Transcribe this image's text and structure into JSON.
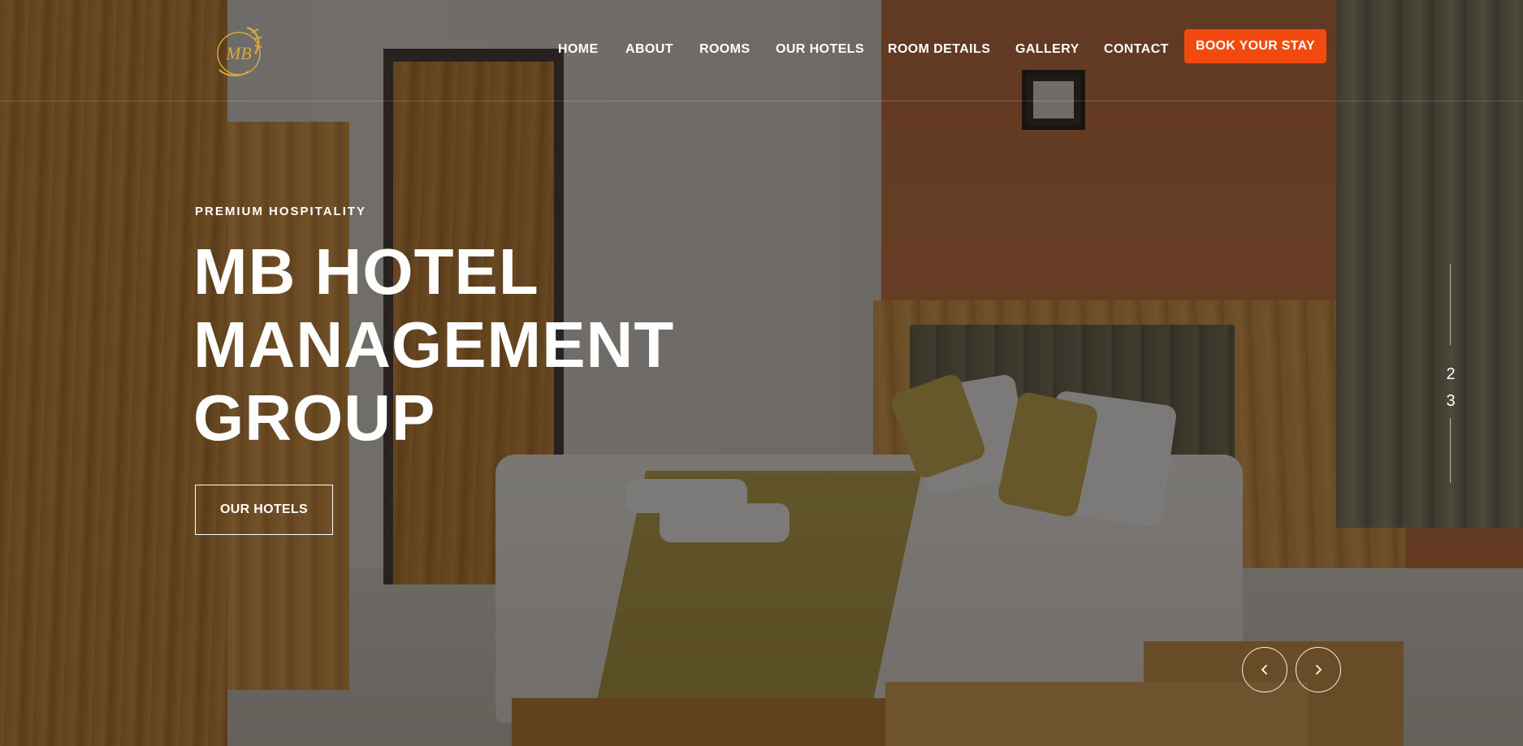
{
  "header": {
    "nav": [
      {
        "id": "home",
        "label": "HOME"
      },
      {
        "id": "about",
        "label": "ABOUT"
      },
      {
        "id": "rooms",
        "label": "ROOMS"
      },
      {
        "id": "our-hotels",
        "label": "OUR HOTELS"
      },
      {
        "id": "room-details",
        "label": "ROOM DETAILS"
      },
      {
        "id": "gallery",
        "label": "GALLERY"
      },
      {
        "id": "contact",
        "label": "CONTACT"
      }
    ],
    "book_button": "BOOK YOUR STAY",
    "logo_text": "MB"
  },
  "hero": {
    "eyebrow": "PREMIUM HOSPITALITY",
    "title_lines": [
      "MB HOTEL",
      "MANAGEMENT",
      "GROUP"
    ],
    "cta": "OUR HOTELS"
  },
  "slider": {
    "numbers": [
      "2",
      "3"
    ]
  },
  "colors": {
    "accent": "#f2490f",
    "logo_gold": "#d4a93c",
    "text": "#ffffff"
  },
  "icons": {
    "prev": "chevron-left-icon",
    "next": "chevron-right-icon",
    "logo": "mb-monogram-logo"
  }
}
